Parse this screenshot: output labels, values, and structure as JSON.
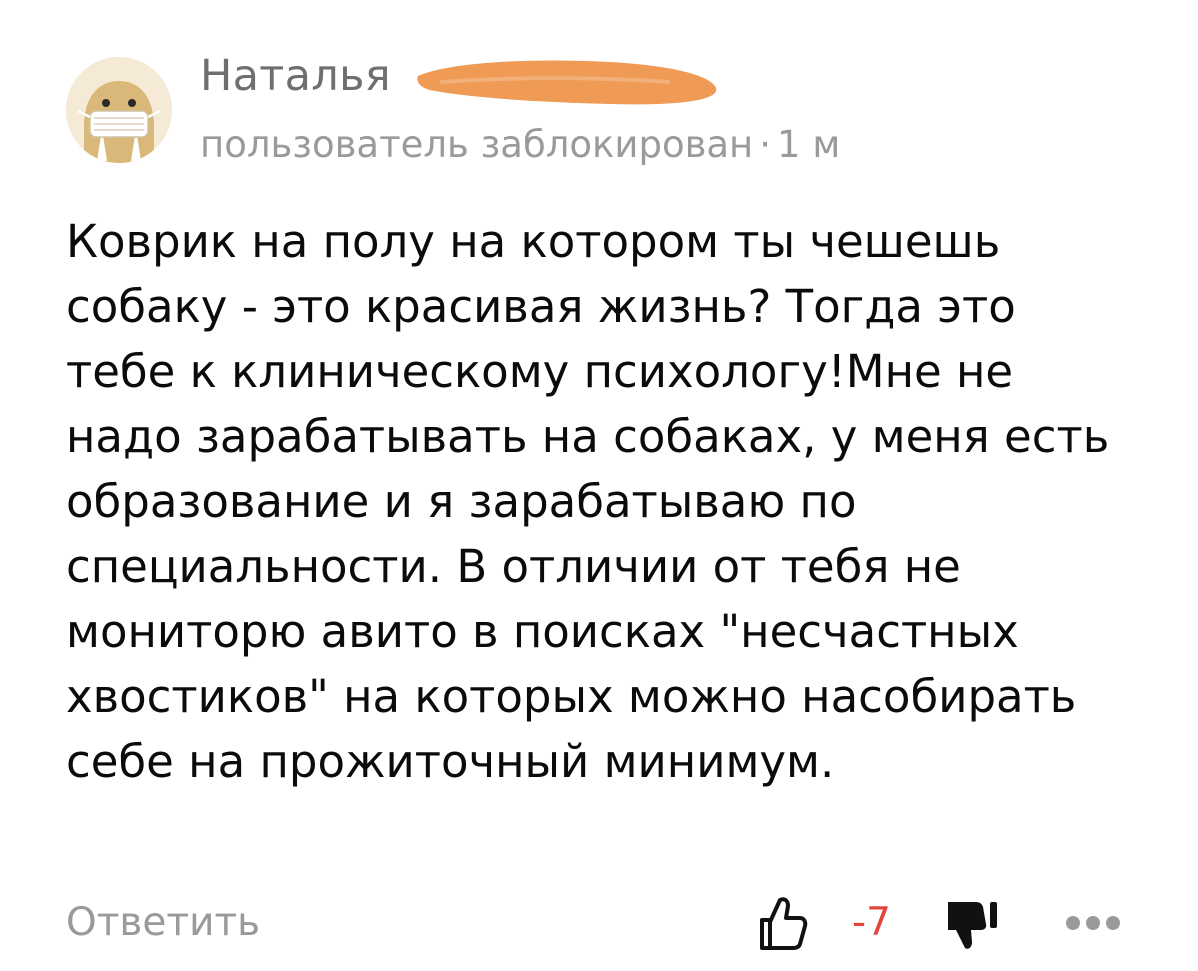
{
  "comment": {
    "author": {
      "name": "Наталья",
      "avatar_icon": "walrus-mask-avatar",
      "redacted_surname": true
    },
    "meta": {
      "status": "пользователь заблокирован",
      "separator": "·",
      "time": "1 м"
    },
    "text_lines": [
      "Коврик на полу на котором ты чешешь",
      "собаку - это красивая жизнь? Тогда это",
      "тебе к клиническому психологу!Мне не",
      "надо зарабатывать на собаках, у меня есть",
      "образование и я зарабатываю по",
      "специальности. В отличии от тебя не",
      "мониторю авито в поисках \"несчастных",
      "хвостиков\" на которых можно насобирать",
      "себе на прожиточный минимум."
    ],
    "actions": {
      "reply_label": "Ответить",
      "like_icon": "thumb-up-outline-icon",
      "rating": "-7",
      "dislike_icon": "thumb-down-filled-icon",
      "more_icon": "more-horizontal-icon"
    }
  },
  "colors": {
    "muted_text": "#9a9a9a",
    "name_text": "#6f6f6f",
    "rating_negative": "#e2453c",
    "redaction_marker": "#ef9a55",
    "avatar_bg": "#f4ead6",
    "avatar_walrus": "#d8b77a"
  }
}
